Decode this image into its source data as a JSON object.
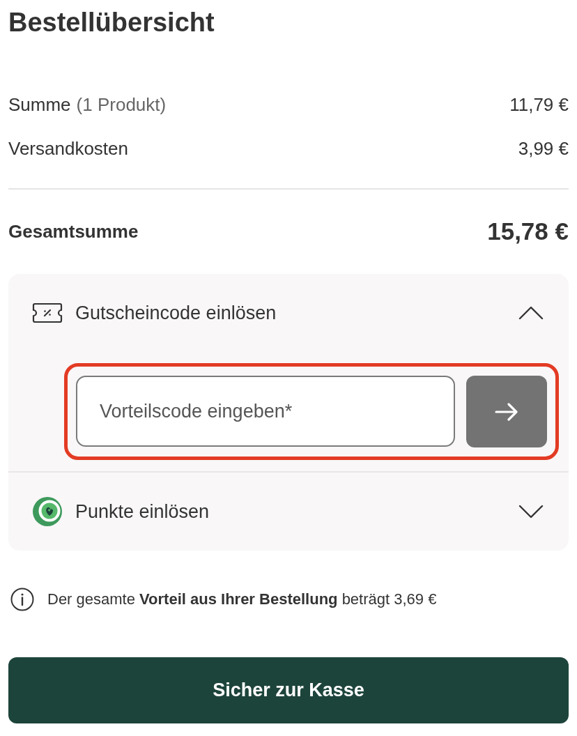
{
  "title": "Bestellübersicht",
  "summary": {
    "rows": [
      {
        "label": "Summe",
        "note": "(1 Produkt)",
        "value": "11,79 €"
      },
      {
        "label": "Versandkosten",
        "value": "3,99 €"
      }
    ],
    "total": {
      "label": "Gesamtsumme",
      "value": "15,78 €"
    }
  },
  "accordions": [
    {
      "kind": "voucher",
      "label": "Gutscheincode einlösen",
      "expanded": true,
      "field": {
        "placeholder": "Vorteilscode eingeben*",
        "highlighted": true
      }
    },
    {
      "kind": "points",
      "label": "Punkte einlösen",
      "expanded": false
    }
  ],
  "info": "Der gesamte **Vorteil aus Ihrer Bestellung** beträgt 3,69 €",
  "checkout_button": "Sicher zur Kasse"
}
